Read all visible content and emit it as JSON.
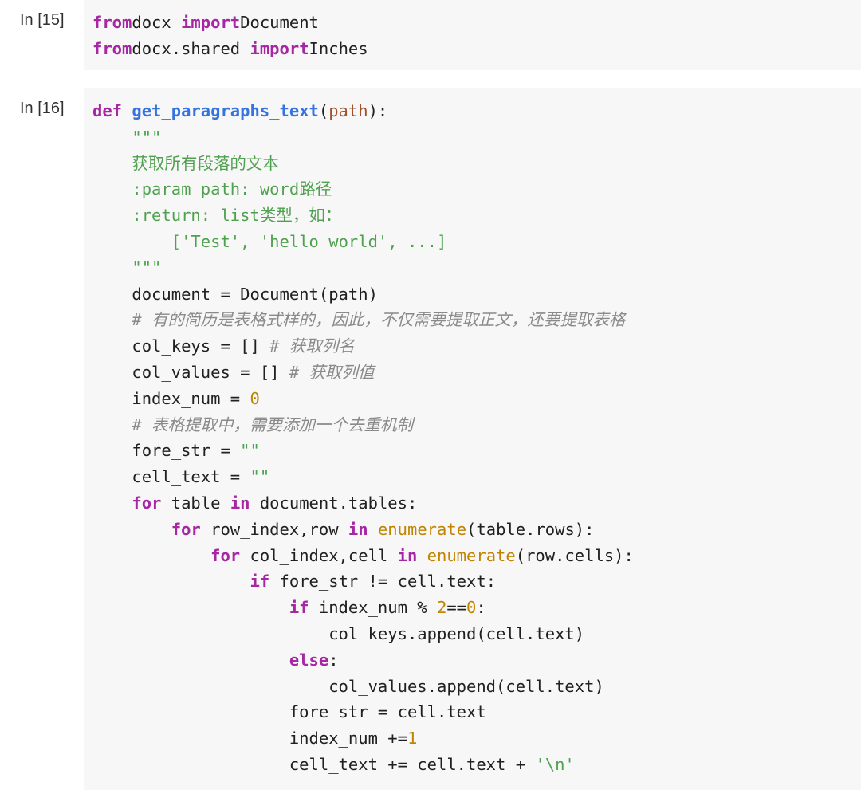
{
  "cells": [
    {
      "prompt": "In [15]",
      "lines": [
        [
          [
            "kw",
            "from"
          ],
          [
            "",
            "docx "
          ],
          [
            "kw",
            "import"
          ],
          [
            "",
            "Document"
          ]
        ],
        [
          [
            "kw",
            "from"
          ],
          [
            "",
            "docx.shared "
          ],
          [
            "kw",
            "import"
          ],
          [
            "",
            "Inches"
          ]
        ]
      ]
    },
    {
      "prompt": "In [16]",
      "lines": [
        [
          [
            "kw",
            "def"
          ],
          [
            "",
            " "
          ],
          [
            "fn",
            "get_paragraphs_text"
          ],
          [
            "",
            "("
          ],
          [
            "par",
            "path"
          ],
          [
            "",
            "):"
          ]
        ],
        [
          [
            "",
            "    "
          ],
          [
            "str",
            "\"\"\""
          ]
        ],
        [
          [
            "",
            "    "
          ],
          [
            "str",
            "获取所有段落的文本"
          ]
        ],
        [
          [
            "",
            "    "
          ],
          [
            "str",
            ":param path: word路径"
          ]
        ],
        [
          [
            "",
            "    "
          ],
          [
            "str",
            ":return: list类型，如："
          ]
        ],
        [
          [
            "",
            "        "
          ],
          [
            "str",
            "['Test', 'hello world', ...]"
          ]
        ],
        [
          [
            "",
            "    "
          ],
          [
            "str",
            "\"\"\""
          ]
        ],
        [
          [
            "",
            "    document = Document(path)"
          ]
        ],
        [
          [
            "",
            "    "
          ],
          [
            "cm",
            "# 有的简历是表格式样的，因此，不仅需要提取正文，还要提取表格"
          ]
        ],
        [
          [
            "",
            "    col_keys = [] "
          ],
          [
            "cm",
            "# 获取列名"
          ]
        ],
        [
          [
            "",
            "    col_values = [] "
          ],
          [
            "cm",
            "# 获取列值"
          ]
        ],
        [
          [
            "",
            "    index_num = "
          ],
          [
            "num",
            "0"
          ]
        ],
        [
          [
            "",
            "    "
          ],
          [
            "cm",
            "# 表格提取中，需要添加一个去重机制"
          ]
        ],
        [
          [
            "",
            "    fore_str = "
          ],
          [
            "str",
            "\"\""
          ]
        ],
        [
          [
            "",
            "    cell_text = "
          ],
          [
            "str",
            "\"\""
          ]
        ],
        [
          [
            "",
            "    "
          ],
          [
            "kw",
            "for"
          ],
          [
            "",
            " table "
          ],
          [
            "kw",
            "in"
          ],
          [
            "",
            " document.tables:"
          ]
        ],
        [
          [
            "",
            "        "
          ],
          [
            "kw",
            "for"
          ],
          [
            "",
            " row_index,row "
          ],
          [
            "kw",
            "in"
          ],
          [
            "",
            " "
          ],
          [
            "bi",
            "enumerate"
          ],
          [
            "",
            "(table.rows):"
          ]
        ],
        [
          [
            "",
            "            "
          ],
          [
            "kw",
            "for"
          ],
          [
            "",
            " col_index,cell "
          ],
          [
            "kw",
            "in"
          ],
          [
            "",
            " "
          ],
          [
            "bi",
            "enumerate"
          ],
          [
            "",
            "(row.cells):"
          ]
        ],
        [
          [
            "",
            "                "
          ],
          [
            "kw",
            "if"
          ],
          [
            "",
            " fore_str != cell.text:"
          ]
        ],
        [
          [
            "",
            "                    "
          ],
          [
            "kw",
            "if"
          ],
          [
            "",
            " index_num % "
          ],
          [
            "num",
            "2"
          ],
          [
            "",
            "=="
          ],
          [
            "num",
            "0"
          ],
          [
            "",
            ":"
          ]
        ],
        [
          [
            "",
            "                        col_keys.append(cell.text)"
          ]
        ],
        [
          [
            "",
            "                    "
          ],
          [
            "kw",
            "else"
          ],
          [
            "",
            ":"
          ]
        ],
        [
          [
            "",
            "                        col_values.append(cell.text)"
          ]
        ],
        [
          [
            "",
            "                    fore_str = cell.text"
          ]
        ],
        [
          [
            "",
            "                    index_num +="
          ],
          [
            "num",
            "1"
          ]
        ],
        [
          [
            "",
            "                    cell_text += cell.text + "
          ],
          [
            "str",
            "'\\n'"
          ]
        ]
      ]
    }
  ]
}
